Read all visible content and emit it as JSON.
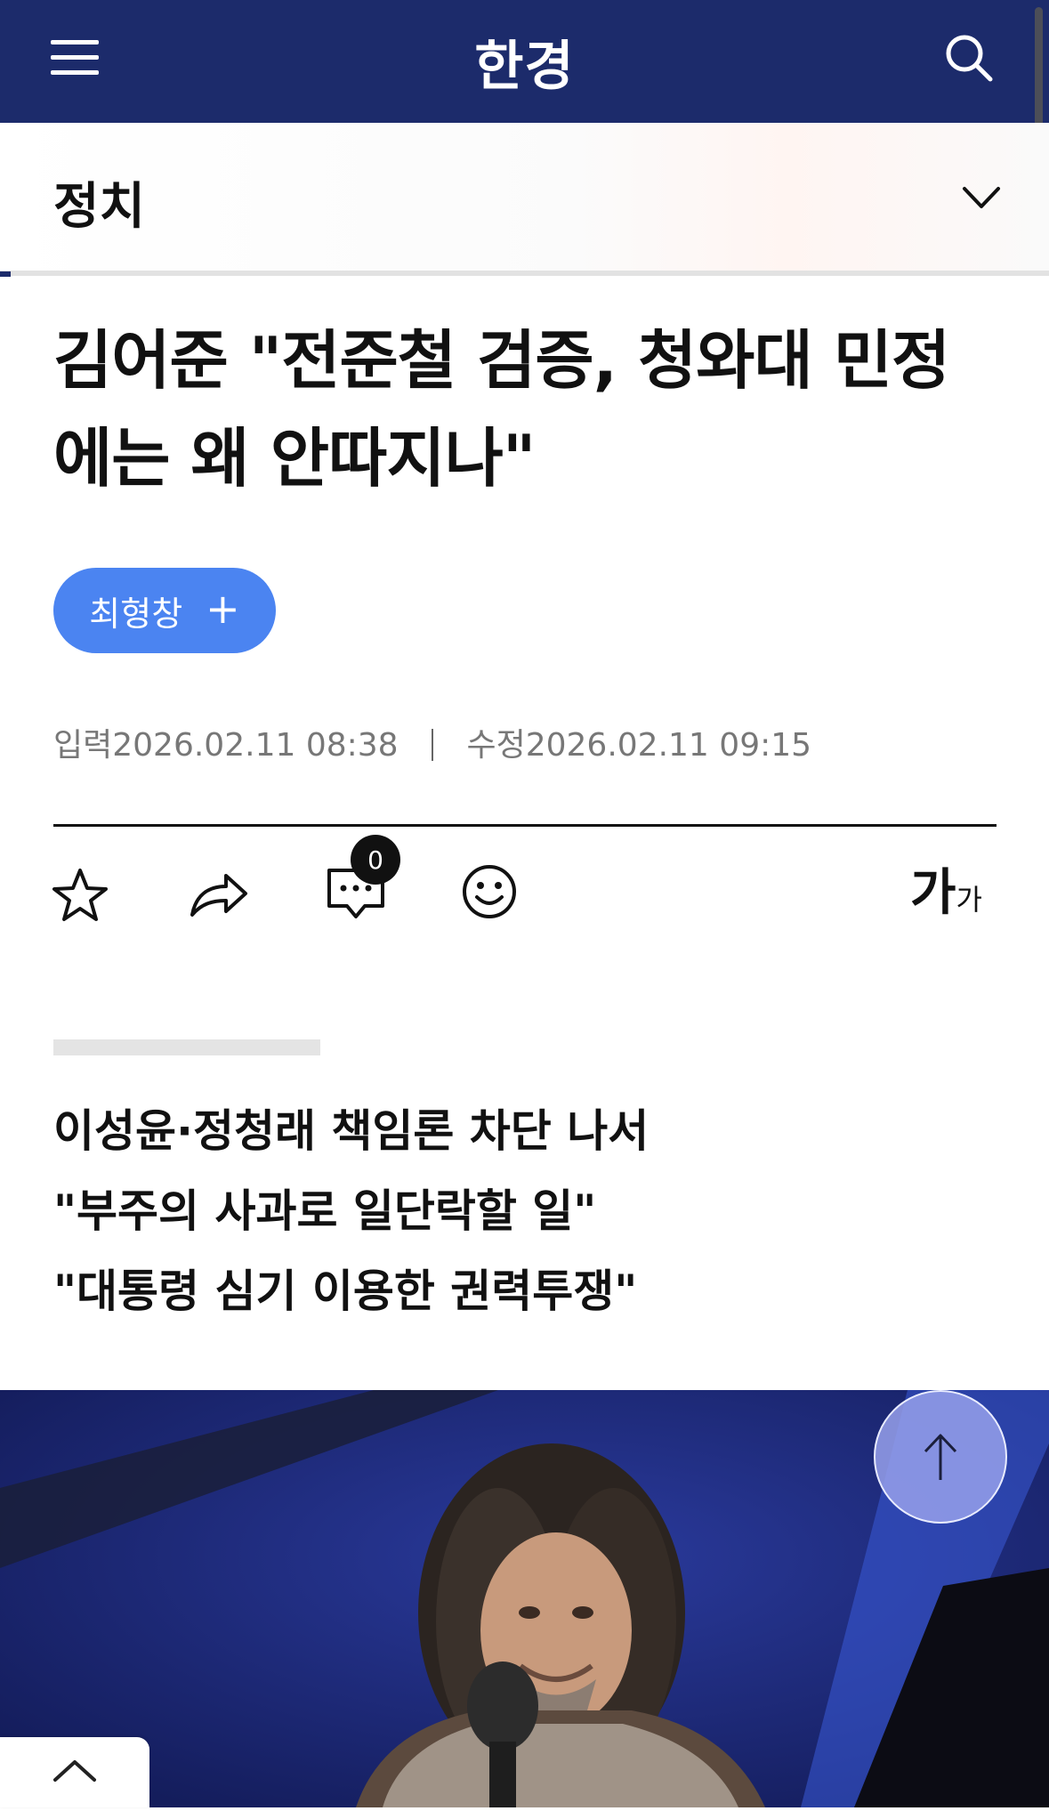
{
  "header": {
    "logo": "한경",
    "menu_icon": "hamburger-menu-icon",
    "search_icon": "search-icon",
    "bg_color": "#1c2b6b"
  },
  "section": {
    "title": "정치",
    "toggle_icon": "chevron-down-icon"
  },
  "article": {
    "headline_line1": "김어준 \"전준철 검증, 청와대 민정",
    "headline_line2": "에는 왜 안따지나\"",
    "reporter": {
      "name": "최형창",
      "action_icon": "plus-icon",
      "color": "#4b84f1"
    },
    "published_label": "입력",
    "published": "2026.02.11 08:38",
    "modified_label": "수정",
    "modified": "2026.02.11 09:15",
    "toolbar": {
      "bookmark_icon": "star-icon",
      "share_icon": "share-icon",
      "comment_icon": "comment-icon",
      "comment_count": "0",
      "reaction_icon": "smile-icon",
      "font_size_big": "가",
      "font_size_small": "가"
    },
    "summary": [
      "이성윤·정청래 책임론 차단 나서",
      "\"부주의 사과로 일단락할 일\"",
      "\"대통령 심기 이용한 권력투쟁\""
    ],
    "photo_subject": "man-with-curly-hair-at-microphone"
  },
  "floating": {
    "scroll_top_icon": "arrow-up-icon",
    "collapse_icon": "chevron-up-icon"
  }
}
